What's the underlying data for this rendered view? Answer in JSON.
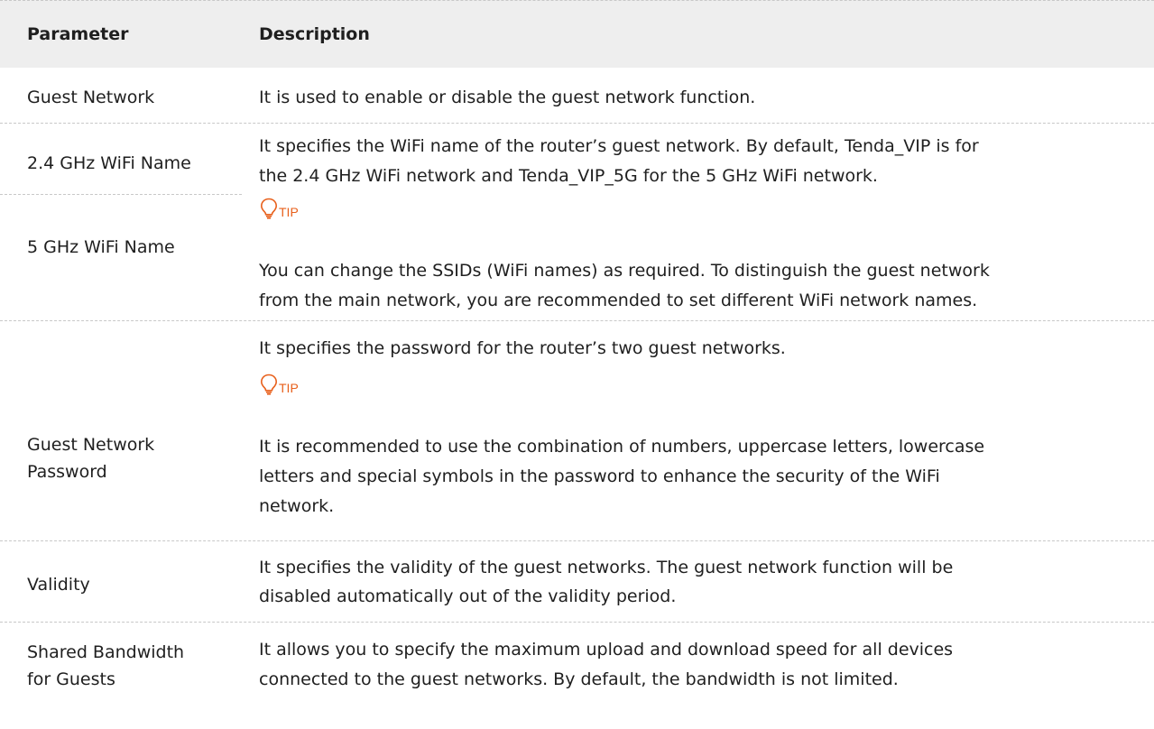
{
  "table": {
    "header": {
      "parameter": "Parameter",
      "description": "Description"
    },
    "rows": {
      "guest_network": {
        "param": "Guest Network",
        "desc": "It is used to enable or disable the guest network function."
      },
      "wifi_name_24": {
        "param": "2.4 GHz WiFi Name"
      },
      "wifi_name_5": {
        "param": "5 GHz WiFi Name"
      },
      "wifi_name_desc": {
        "line1": "It specifies the WiFi name of the router’s guest network. By default, Tenda_VIP is for",
        "line2": "the 2.4 GHz WiFi network and Tenda_VIP_5G for the 5 GHz WiFi network.",
        "tip_label": "TIP",
        "tip_line1": "You can change the SSIDs (WiFi names) as required. To distinguish the guest network",
        "tip_line2": "from the main network, you are recommended to set different WiFi network names."
      },
      "password": {
        "param_line1": "Guest Network",
        "param_line2": "Password",
        "desc": "It specifies the password for the router’s two guest networks.",
        "tip_label": "TIP",
        "tip_line1": "It is recommended to use the combination of numbers, uppercase letters, lowercase",
        "tip_line2": "letters and special symbols in the password to enhance the security of the WiFi",
        "tip_line3": "network."
      },
      "validity": {
        "param": "Validity",
        "desc_line1": "It specifies the validity of the guest networks. The guest network function will be",
        "desc_line2": "disabled automatically out of the validity period."
      },
      "bandwidth": {
        "param_line1": "Shared Bandwidth",
        "param_line2": "for Guests",
        "desc_line1": "It allows you to specify the maximum upload and download speed for all devices",
        "desc_line2": "connected to the guest networks. By default, the bandwidth is not limited."
      }
    }
  },
  "colors": {
    "header_bg": "#eeeeee",
    "text": "#1f1f1f",
    "tip_accent": "#e8601c",
    "rule": "#c8c8c8"
  },
  "icons": {
    "tip": "lightbulb-icon"
  }
}
